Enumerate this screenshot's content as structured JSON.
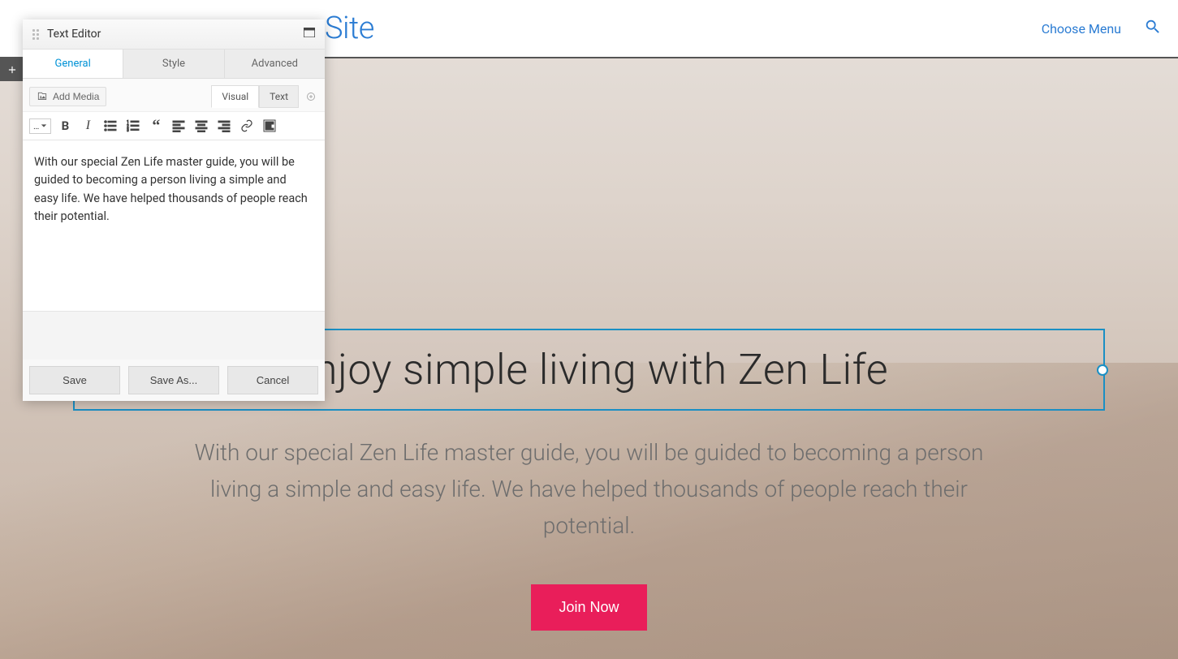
{
  "site": {
    "title_fragment": "Site"
  },
  "nav": {
    "menu_link": "Choose Menu"
  },
  "hero": {
    "heading": "Enjoy simple living with Zen Life",
    "subtext": "With our special Zen Life master guide, you will be guided to becoming a person living a simple and easy life. We have helped thousands of people reach their potential.",
    "cta": "Join Now"
  },
  "editor": {
    "title": "Text Editor",
    "tabs": {
      "general": "General",
      "style": "Style",
      "advanced": "Advanced"
    },
    "add_media": "Add Media",
    "mode": {
      "visual": "Visual",
      "text": "Text"
    },
    "paragraph_selector": "…",
    "content": "With our special Zen Life master guide, you will be guided to becoming a person living a simple and easy life. We have helped thousands of people reach their potential.",
    "buttons": {
      "save": "Save",
      "save_as": "Save As...",
      "cancel": "Cancel"
    }
  }
}
